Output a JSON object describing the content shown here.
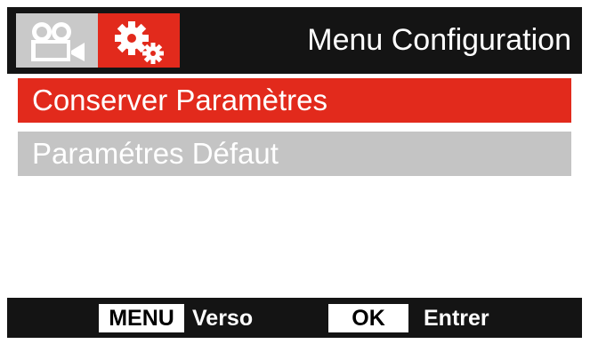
{
  "header": {
    "title": "Menu Configuration",
    "tabs": [
      {
        "icon": "video-camera-icon",
        "active": false,
        "color": "#c9c9c9"
      },
      {
        "icon": "gears-icon",
        "active": true,
        "color": "#e22a1c"
      }
    ]
  },
  "menu": {
    "items": [
      {
        "label": "Conserver Paramètres",
        "selected": true
      },
      {
        "label": "Paramétres Défaut",
        "selected": false
      }
    ]
  },
  "footer": {
    "menu_key": "MENU",
    "menu_action": "Verso",
    "ok_key": "OK",
    "ok_action": "Entrer"
  },
  "colors": {
    "accent": "#e22a1c",
    "header_bg": "#141414",
    "inactive": "#c4c4c4"
  }
}
